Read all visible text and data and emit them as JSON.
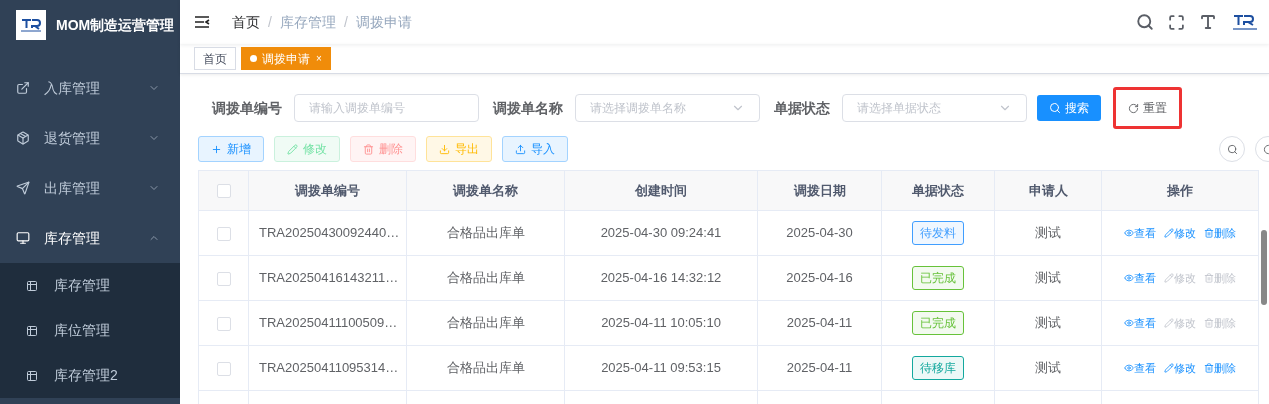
{
  "app": {
    "title": "MOM制造运营管理"
  },
  "sidebar": {
    "items": [
      {
        "label": "入库管理",
        "expanded": false
      },
      {
        "label": "退货管理",
        "expanded": false
      },
      {
        "label": "出库管理",
        "expanded": false
      },
      {
        "label": "库存管理",
        "expanded": true,
        "children": [
          {
            "label": "库存管理"
          },
          {
            "label": "库位管理"
          },
          {
            "label": "库存管理2"
          }
        ]
      }
    ]
  },
  "breadcrumb": {
    "separator": "/",
    "items": [
      "首页",
      "库存管理",
      "调拨申请"
    ]
  },
  "tabs": [
    {
      "label": "首页",
      "selected": false,
      "closable": false
    },
    {
      "label": "调拨申请",
      "selected": true,
      "closable": true,
      "close": "×"
    }
  ],
  "filters": [
    {
      "label": "调拨单编号",
      "placeholder": "请输入调拨单编号",
      "kind": "input"
    },
    {
      "label": "调拨单名称",
      "placeholder": "请选择调拨单名称",
      "kind": "select"
    },
    {
      "label": "单据状态",
      "placeholder": "请选择单据状态",
      "kind": "select"
    }
  ],
  "search_button": "搜索",
  "reset_button": {
    "label": "重置",
    "highlighted": true
  },
  "toolbar": [
    {
      "label": "新增",
      "kind": "add",
      "disabled": false
    },
    {
      "label": "修改",
      "kind": "edit",
      "disabled": true
    },
    {
      "label": "删除",
      "kind": "delete",
      "disabled": true
    },
    {
      "label": "导出",
      "kind": "export",
      "disabled": false
    },
    {
      "label": "导入",
      "kind": "import",
      "disabled": false
    }
  ],
  "table": {
    "select_all_checked": false,
    "columns": [
      "调拨单编号",
      "调拨单名称",
      "创建时间",
      "调拨日期",
      "单据状态",
      "申请人",
      "操作"
    ],
    "rows": [
      {
        "checked": false,
        "code": "TRA20250430092440…",
        "name": "合格品出库单",
        "created": "2025-04-30 09:24:41",
        "date": "2025-04-30",
        "status": {
          "label": "待发料",
          "color": "#409eff"
        },
        "applicant": "测试",
        "actions": [
          {
            "label": "查看",
            "kind": "view",
            "disabled": false
          },
          {
            "label": "修改",
            "kind": "edit",
            "disabled": false
          },
          {
            "label": "删除",
            "kind": "delete",
            "disabled": false
          }
        ]
      },
      {
        "checked": false,
        "code": "TRA20250416143211…",
        "name": "合格品出库单",
        "created": "2025-04-16 14:32:12",
        "date": "2025-04-16",
        "status": {
          "label": "已完成",
          "color": "#67c23a"
        },
        "applicant": "测试",
        "actions": [
          {
            "label": "查看",
            "kind": "view",
            "disabled": false
          },
          {
            "label": "修改",
            "kind": "edit",
            "disabled": true
          },
          {
            "label": "删除",
            "kind": "delete",
            "disabled": true
          }
        ]
      },
      {
        "checked": false,
        "code": "TRA20250411100509…",
        "name": "合格品出库单",
        "created": "2025-04-11 10:05:10",
        "date": "2025-04-11",
        "status": {
          "label": "已完成",
          "color": "#67c23a"
        },
        "applicant": "测试",
        "actions": [
          {
            "label": "查看",
            "kind": "view",
            "disabled": false
          },
          {
            "label": "修改",
            "kind": "edit",
            "disabled": true
          },
          {
            "label": "删除",
            "kind": "delete",
            "disabled": true
          }
        ]
      },
      {
        "checked": false,
        "code": "TRA20250411095314…",
        "name": "合格品出库单",
        "created": "2025-04-11 09:53:15",
        "date": "2025-04-11",
        "status": {
          "label": "待移库",
          "color": "#13a89e"
        },
        "applicant": "测试",
        "actions": [
          {
            "label": "查看",
            "kind": "view",
            "disabled": false
          },
          {
            "label": "修改",
            "kind": "edit",
            "disabled": false
          },
          {
            "label": "删除",
            "kind": "delete",
            "disabled": false
          }
        ]
      }
    ]
  }
}
